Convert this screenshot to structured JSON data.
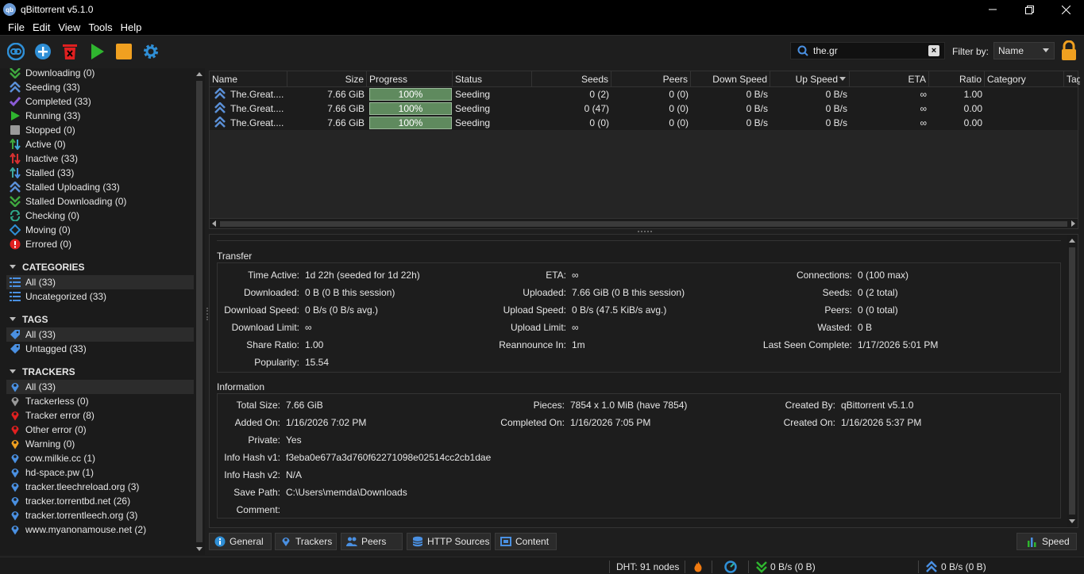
{
  "window": {
    "title": "qBittorrent v5.1.0",
    "logo_text": "qb"
  },
  "menu": [
    "File",
    "Edit",
    "View",
    "Tools",
    "Help"
  ],
  "toolbar": {
    "buttons": [
      "link-icon",
      "add-icon",
      "delete-icon",
      "start-icon",
      "stop-icon",
      "options-icon"
    ],
    "search_value": "the.gr",
    "filter_label": "Filter by:",
    "filter_value": "Name"
  },
  "sidebar": {
    "status": [
      {
        "label": "Downloading (0)",
        "icon": "download-icon",
        "color": "#3fa83f"
      },
      {
        "label": "Seeding (33)",
        "icon": "seeding-icon",
        "color": "#5a8fd6"
      },
      {
        "label": "Completed (33)",
        "icon": "checkmark-icon",
        "color": "#8a5bd6"
      },
      {
        "label": "Running (33)",
        "icon": "play-icon",
        "color": "#2fb52f"
      },
      {
        "label": "Stopped (0)",
        "icon": "stop-icon",
        "color": "#9a9a9a"
      },
      {
        "label": "Active (0)",
        "icon": "active-icon",
        "color": "#3fa83f"
      },
      {
        "label": "Inactive (33)",
        "icon": "inactive-icon",
        "color": "#d63030"
      },
      {
        "label": "Stalled (33)",
        "icon": "stalled-icon",
        "color": "#3fa8a0"
      },
      {
        "label": "Stalled Uploading (33)",
        "icon": "stalled-uploading-icon",
        "color": "#5a8fd6"
      },
      {
        "label": "Stalled Downloading (0)",
        "icon": "stalled-downloading-icon",
        "color": "#3fa83f"
      },
      {
        "label": "Checking (0)",
        "icon": "checking-icon",
        "color": "#2fa88a"
      },
      {
        "label": "Moving (0)",
        "icon": "moving-icon",
        "color": "#2f8fd6"
      },
      {
        "label": "Errored (0)",
        "icon": "error-icon",
        "color": "#e02020"
      }
    ],
    "categories_title": "CATEGORIES",
    "categories": [
      "All (33)",
      "Uncategorized (33)"
    ],
    "tags_title": "TAGS",
    "tags": [
      "All (33)",
      "Untagged (33)"
    ],
    "trackers_title": "TRACKERS",
    "trackers": [
      {
        "label": "All (33)",
        "color": "#4a90e2"
      },
      {
        "label": "Trackerless (0)",
        "color": "#9a9a9a"
      },
      {
        "label": "Tracker error (8)",
        "color": "#e02020"
      },
      {
        "label": "Other error (0)",
        "color": "#e02020"
      },
      {
        "label": "Warning (0)",
        "color": "#f0a020"
      },
      {
        "label": "cow.milkie.cc (1)",
        "color": "#4a90e2"
      },
      {
        "label": "hd-space.pw (1)",
        "color": "#4a90e2"
      },
      {
        "label": "tracker.tleechreload.org (3)",
        "color": "#4a90e2"
      },
      {
        "label": "tracker.torrentbd.net (26)",
        "color": "#4a90e2"
      },
      {
        "label": "tracker.torrentleech.org (3)",
        "color": "#4a90e2"
      },
      {
        "label": "www.myanonamouse.net (2)",
        "color": "#4a90e2"
      }
    ]
  },
  "torrents": {
    "columns": [
      "Name",
      "Size",
      "Progress",
      "Status",
      "Seeds",
      "Peers",
      "Down Speed",
      "Up Speed",
      "ETA",
      "Ratio",
      "Category",
      "Tag"
    ],
    "rows": [
      {
        "name": "The.Great....",
        "size": "7.66 GiB",
        "progress": "100%",
        "progress_value": 1.0,
        "status": "Seeding",
        "seeds": "0 (2)",
        "peers": "0 (0)",
        "down": "0 B/s",
        "up": "0 B/s",
        "eta": "∞",
        "ratio": "1.00"
      },
      {
        "name": "The.Great....",
        "size": "7.66 GiB",
        "progress": "100%",
        "progress_value": 1.0,
        "status": "Seeding",
        "seeds": "0 (47)",
        "peers": "0 (0)",
        "down": "0 B/s",
        "up": "0 B/s",
        "eta": "∞",
        "ratio": "0.00"
      },
      {
        "name": "The.Great....",
        "size": "7.66 GiB",
        "progress": "100%",
        "progress_value": 1.0,
        "status": "Seeding",
        "seeds": "0 (0)",
        "peers": "0 (0)",
        "down": "0 B/s",
        "up": "0 B/s",
        "eta": "∞",
        "ratio": "0.00"
      }
    ]
  },
  "transfer": {
    "title": "Transfer",
    "col1": [
      {
        "k": "Time Active:",
        "v": "1d 22h (seeded for 1d 22h)"
      },
      {
        "k": "Downloaded:",
        "v": "0 B (0 B this session)"
      },
      {
        "k": "Download Speed:",
        "v": "0 B/s (0 B/s avg.)"
      },
      {
        "k": "Download Limit:",
        "v": "∞"
      },
      {
        "k": "Share Ratio:",
        "v": "1.00"
      },
      {
        "k": "Popularity:",
        "v": "15.54"
      }
    ],
    "col2": [
      {
        "k": "ETA:",
        "v": "∞"
      },
      {
        "k": "Uploaded:",
        "v": "7.66 GiB (0 B this session)"
      },
      {
        "k": "Upload Speed:",
        "v": "0 B/s (47.5 KiB/s avg.)"
      },
      {
        "k": "Upload Limit:",
        "v": "∞"
      },
      {
        "k": "Reannounce In:",
        "v": "1m"
      }
    ],
    "col3": [
      {
        "k": "Connections:",
        "v": "0 (100 max)"
      },
      {
        "k": "Seeds:",
        "v": "0 (2 total)"
      },
      {
        "k": "Peers:",
        "v": "0 (0 total)"
      },
      {
        "k": "Wasted:",
        "v": "0 B"
      },
      {
        "k": "Last Seen Complete:",
        "v": "1/17/2026 5:01 PM"
      }
    ]
  },
  "information": {
    "title": "Information",
    "col1": [
      {
        "k": "Total Size:",
        "v": "7.66 GiB"
      },
      {
        "k": "Added On:",
        "v": "1/16/2026 7:02 PM"
      },
      {
        "k": "Private:",
        "v": "Yes"
      },
      {
        "k": "Info Hash v1:",
        "v": "f3eba0e677a3d760f62271098e02514cc2cb1dae"
      },
      {
        "k": "Info Hash v2:",
        "v": "N/A"
      },
      {
        "k": "Save Path:",
        "v": "C:\\Users\\memda\\Downloads"
      },
      {
        "k": "Comment:",
        "v": ""
      }
    ],
    "col2": [
      {
        "k": "Pieces:",
        "v": "7854 x 1.0 MiB (have 7854)"
      },
      {
        "k": "Completed On:",
        "v": "1/16/2026 7:05 PM"
      }
    ],
    "col3": [
      {
        "k": "Created By:",
        "v": "qBittorrent v5.1.0"
      },
      {
        "k": "Created On:",
        "v": "1/16/2026 5:37 PM"
      }
    ]
  },
  "tabs": [
    "General",
    "Trackers",
    "Peers",
    "HTTP Sources",
    "Content"
  ],
  "speed_button": "Speed",
  "statusbar": {
    "dht": "DHT: 91 nodes",
    "down": "0 B/s (0 B)",
    "up": "0 B/s (0 B)"
  },
  "colors": {
    "progress_fill": "#5f8a5e",
    "accent_blue": "#2f8fd6",
    "stop_orange": "#f0a020"
  }
}
